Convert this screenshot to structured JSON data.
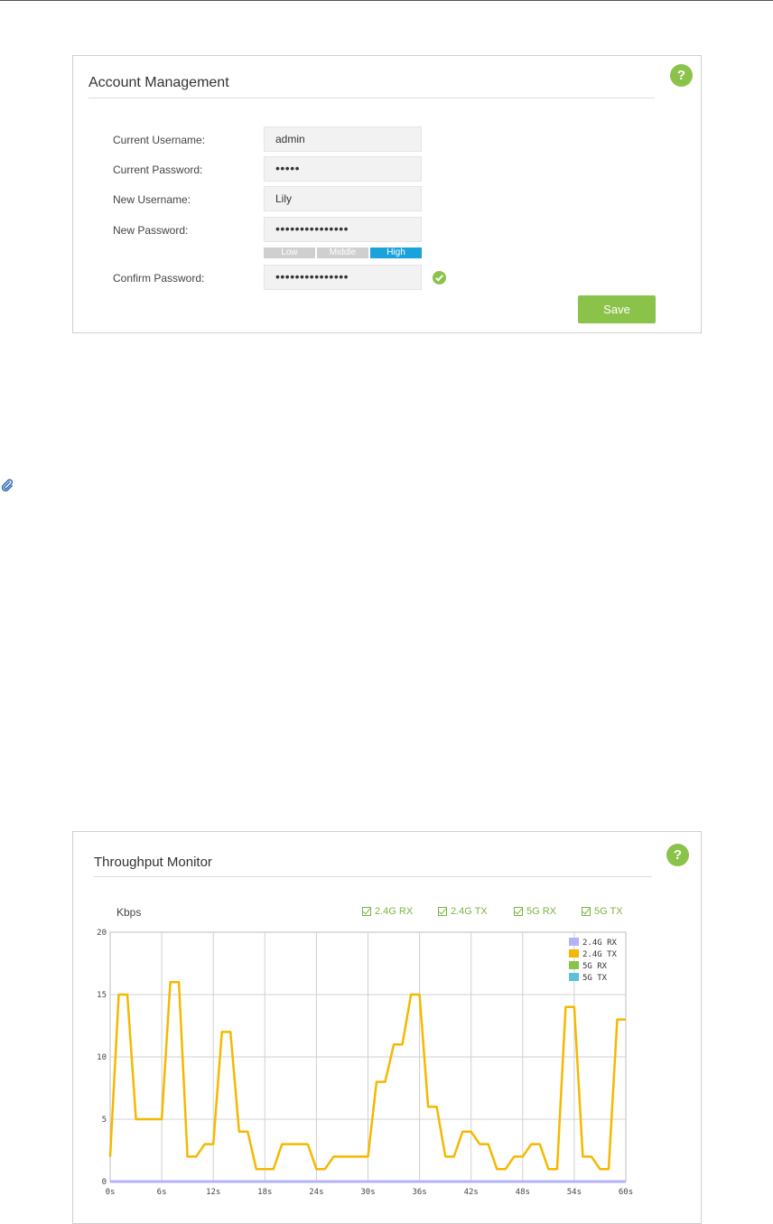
{
  "account": {
    "title": "Account Management",
    "help": "?",
    "fields": [
      {
        "label": "Current Username:",
        "value": "admin"
      },
      {
        "label": "Current Password:",
        "value": "•••••"
      },
      {
        "label": "New Username:",
        "value": "Lily"
      },
      {
        "label": "New Password:",
        "value": "•••••••••••••••"
      },
      {
        "label": "Confirm Password:",
        "value": "•••••••••••••••"
      }
    ],
    "strength": {
      "low": "Low",
      "middle": "Middle",
      "high": "High",
      "level": "High"
    },
    "save_label": "Save"
  },
  "throughput": {
    "title": "Throughput Monitor",
    "help": "?",
    "unit": "Kbps",
    "toggles": [
      {
        "label": "2.4G RX",
        "checked": true
      },
      {
        "label": "2.4G TX",
        "checked": true
      },
      {
        "label": "5G RX",
        "checked": true
      },
      {
        "label": "5G TX",
        "checked": true
      }
    ]
  },
  "chart_data": {
    "type": "line",
    "ylabel": "Kbps",
    "xlim": [
      0,
      60
    ],
    "ylim": [
      0,
      20
    ],
    "x_ticks": [
      "0s",
      "6s",
      "12s",
      "18s",
      "24s",
      "30s",
      "36s",
      "42s",
      "48s",
      "54s",
      "60s"
    ],
    "y_ticks": [
      "0",
      "5",
      "10",
      "15",
      "20"
    ],
    "grid": true,
    "legend_position": "top-right",
    "series": [
      {
        "name": "2.4G RX",
        "color": "#b3b3f5",
        "x": [
          0,
          60
        ],
        "y": [
          0,
          0
        ]
      },
      {
        "name": "2.4G TX",
        "color": "#f5b800",
        "x": [
          0,
          1,
          2,
          3,
          4,
          5,
          6,
          7,
          8,
          9,
          10,
          11,
          12,
          13,
          14,
          15,
          16,
          17,
          18,
          19,
          20,
          21,
          22,
          23,
          24,
          25,
          26,
          27,
          28,
          29,
          30,
          31,
          32,
          33,
          34,
          35,
          36,
          37,
          38,
          39,
          40,
          41,
          42,
          43,
          44,
          45,
          46,
          47,
          48,
          49,
          50,
          51,
          52,
          53,
          54,
          55,
          56,
          57,
          58,
          59,
          60
        ],
        "y": [
          2,
          15,
          15,
          5,
          5,
          5,
          5,
          16,
          16,
          2,
          2,
          3,
          3,
          12,
          12,
          4,
          4,
          1,
          1,
          1,
          3,
          3,
          3,
          3,
          1,
          1,
          2,
          2,
          2,
          2,
          2,
          8,
          8,
          11,
          11,
          15,
          15,
          6,
          6,
          2,
          2,
          4,
          4,
          3,
          3,
          1,
          1,
          2,
          2,
          3,
          3,
          1,
          1,
          14,
          14,
          2,
          2,
          1,
          1,
          13,
          13
        ]
      },
      {
        "name": "5G RX",
        "color": "#8bc34a",
        "x": [
          0,
          60
        ],
        "y": [
          0,
          0
        ]
      },
      {
        "name": "5G TX",
        "color": "#5bc0de",
        "x": [
          0,
          60
        ],
        "y": [
          0,
          0
        ]
      }
    ]
  }
}
